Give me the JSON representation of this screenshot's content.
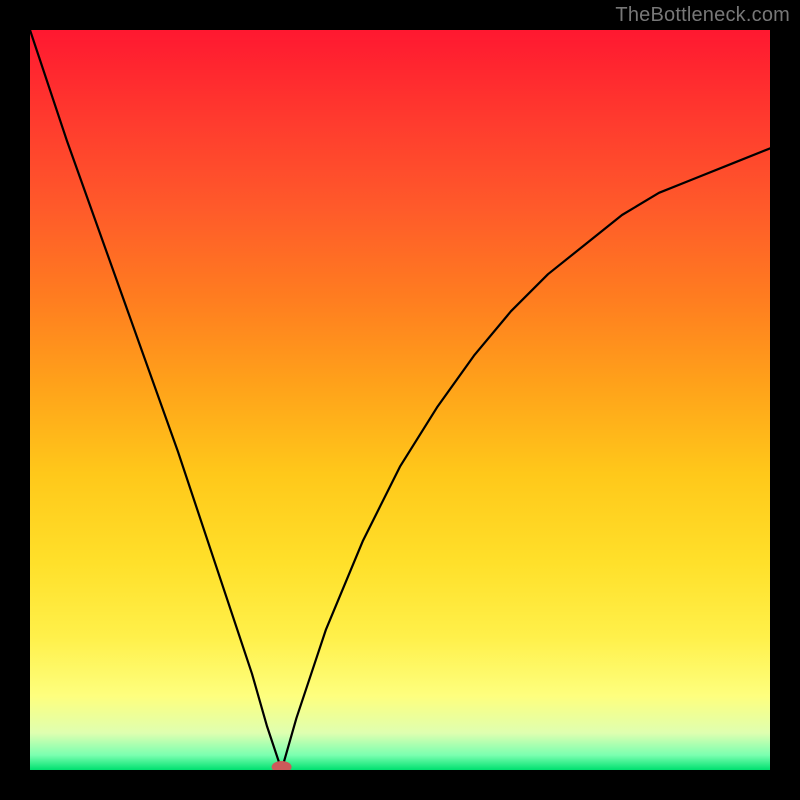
{
  "attribution": "TheBottleneck.com",
  "chart_data": {
    "type": "line",
    "title": "",
    "xlabel": "",
    "ylabel": "",
    "xlim": [
      0,
      100
    ],
    "ylim": [
      0,
      100
    ],
    "minimum_marker": {
      "x": 34,
      "y": 0
    },
    "series": [
      {
        "name": "curve",
        "x": [
          0,
          5,
          10,
          15,
          20,
          25,
          30,
          32,
          34,
          36,
          38,
          40,
          45,
          50,
          55,
          60,
          65,
          70,
          75,
          80,
          85,
          90,
          95,
          100
        ],
        "values": [
          100,
          85,
          71,
          57,
          43,
          28,
          13,
          6,
          0,
          7,
          13,
          19,
          31,
          41,
          49,
          56,
          62,
          67,
          71,
          75,
          78,
          80,
          82,
          84
        ]
      }
    ],
    "colors": {
      "gradient_top": "#ff1830",
      "gradient_bottom": "#00e070",
      "curve": "#000000",
      "marker": "#cc5a5a"
    }
  }
}
